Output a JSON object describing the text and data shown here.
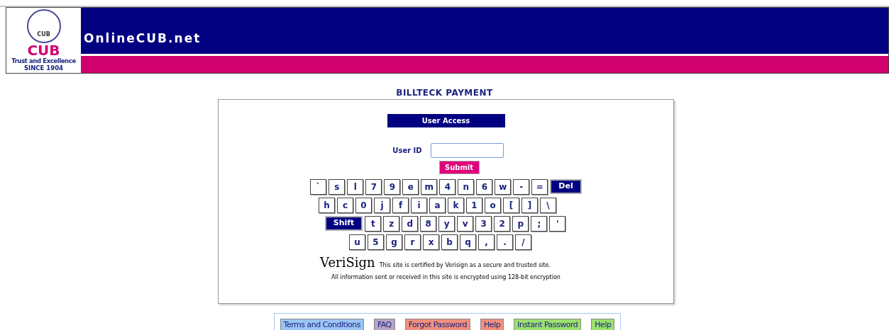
{
  "header": {
    "logo_emblem": "CUB",
    "logo_text": "CUB",
    "tagline": "Trust and Excellence",
    "since": "SINCE 1904",
    "site_name": "OnlineCUB.net"
  },
  "page_title": "BILLTECK PAYMENT",
  "panel": {
    "heading": "User Access",
    "field_label": "User ID",
    "submit": "Submit",
    "keyboard": [
      [
        {
          "label": "`",
          "kind": "char"
        },
        {
          "label": "s",
          "kind": "char"
        },
        {
          "label": "l",
          "kind": "char"
        },
        {
          "label": "7",
          "kind": "char"
        },
        {
          "label": "9",
          "kind": "char"
        },
        {
          "label": "e",
          "kind": "char"
        },
        {
          "label": "m",
          "kind": "char"
        },
        {
          "label": "4",
          "kind": "char"
        },
        {
          "label": "n",
          "kind": "char"
        },
        {
          "label": "6",
          "kind": "char"
        },
        {
          "label": "w",
          "kind": "char"
        },
        {
          "label": "-",
          "kind": "char"
        },
        {
          "label": "=",
          "kind": "char"
        },
        {
          "label": "Del",
          "kind": "action"
        }
      ],
      [
        {
          "label": "h",
          "kind": "char"
        },
        {
          "label": "c",
          "kind": "char"
        },
        {
          "label": "0",
          "kind": "char"
        },
        {
          "label": "j",
          "kind": "char"
        },
        {
          "label": "f",
          "kind": "char"
        },
        {
          "label": "i",
          "kind": "char"
        },
        {
          "label": "a",
          "kind": "char"
        },
        {
          "label": "k",
          "kind": "char"
        },
        {
          "label": "1",
          "kind": "char"
        },
        {
          "label": "o",
          "kind": "char"
        },
        {
          "label": "[",
          "kind": "char"
        },
        {
          "label": "]",
          "kind": "char"
        },
        {
          "label": "\\",
          "kind": "char"
        }
      ],
      [
        {
          "label": "Shift",
          "kind": "action"
        },
        {
          "label": "t",
          "kind": "char"
        },
        {
          "label": "z",
          "kind": "char"
        },
        {
          "label": "d",
          "kind": "char"
        },
        {
          "label": "8",
          "kind": "char"
        },
        {
          "label": "y",
          "kind": "char"
        },
        {
          "label": "v",
          "kind": "char"
        },
        {
          "label": "3",
          "kind": "char"
        },
        {
          "label": "2",
          "kind": "char"
        },
        {
          "label": "p",
          "kind": "char"
        },
        {
          "label": ";",
          "kind": "char"
        },
        {
          "label": "'",
          "kind": "char"
        }
      ],
      [
        {
          "label": "u",
          "kind": "char"
        },
        {
          "label": "5",
          "kind": "char"
        },
        {
          "label": "g",
          "kind": "char"
        },
        {
          "label": "r",
          "kind": "char"
        },
        {
          "label": "x",
          "kind": "char"
        },
        {
          "label": "b",
          "kind": "char"
        },
        {
          "label": "q",
          "kind": "char"
        },
        {
          "label": ",",
          "kind": "char"
        },
        {
          "label": ".",
          "kind": "char"
        },
        {
          "label": "/",
          "kind": "char"
        }
      ]
    ],
    "verisign_logo": "VeriSign",
    "certified_text": "This site is certified by Verisign as a secure and trusted site.",
    "encryption_text": "All information sent or received in this site is encrypted using 128-bit encryption"
  },
  "footer_links": [
    {
      "label": "Terms and Conditions",
      "color": "#9cc4f4"
    },
    {
      "label": "FAQ",
      "color": "#b8a4c4"
    },
    {
      "label": "Forgot Password",
      "color": "#f0907c"
    },
    {
      "label": "Help",
      "color": "#f0907c"
    },
    {
      "label": "Instant Password",
      "color": "#9ce070"
    },
    {
      "label": "Help",
      "color": "#9ce070"
    }
  ]
}
